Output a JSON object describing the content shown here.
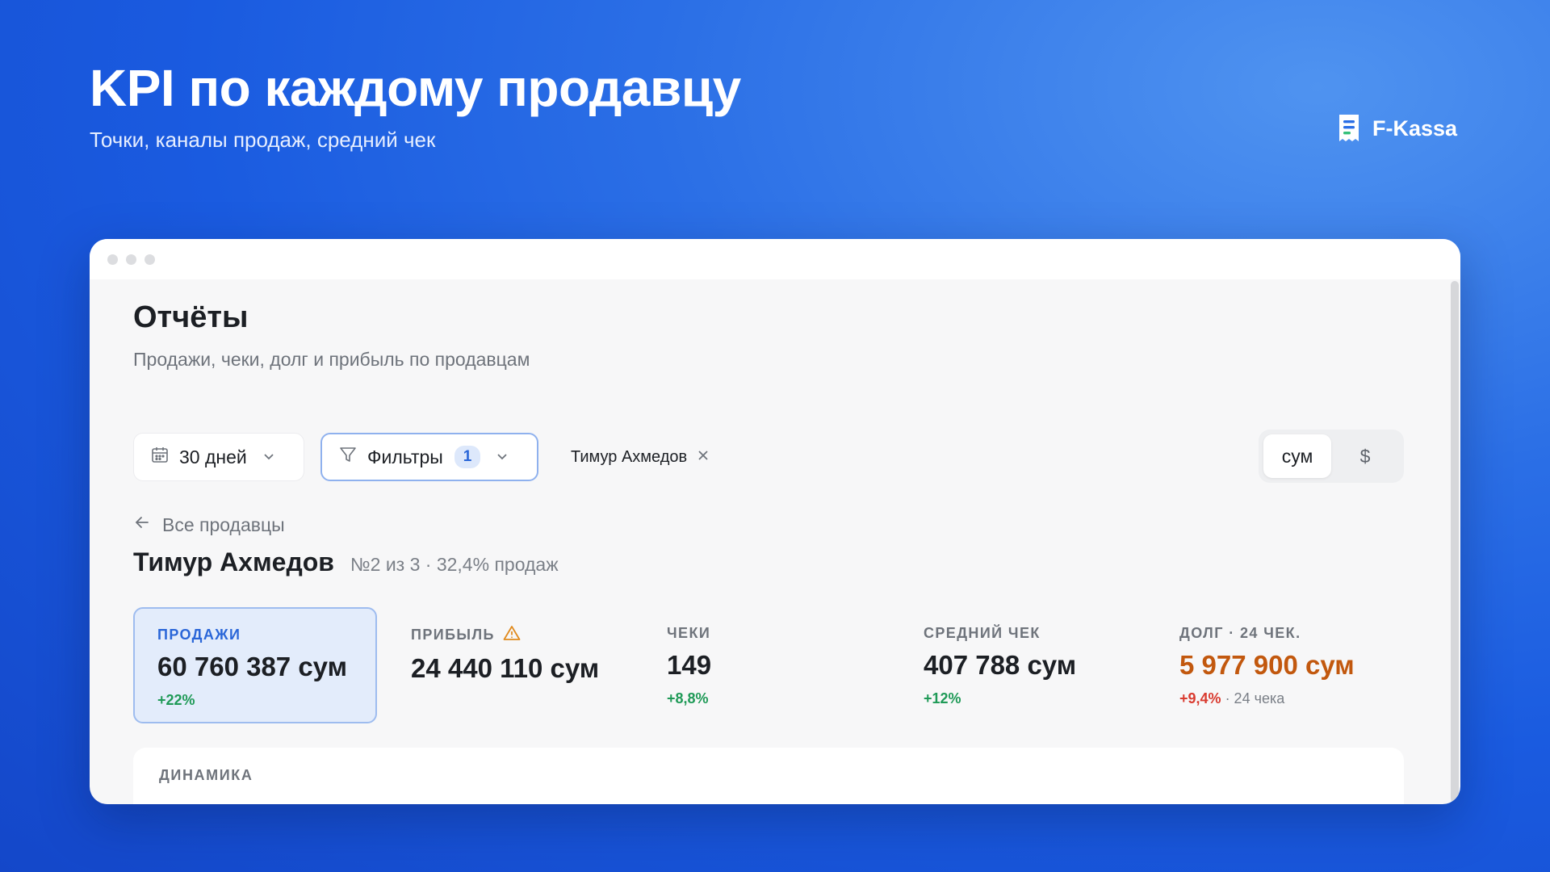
{
  "hero": {
    "title": "KPI по каждому продавцу",
    "subtitle": "Точки, каналы продаж, средний чек"
  },
  "brand": {
    "name": "F-Kassa",
    "icon": "receipt-logo-icon"
  },
  "page": {
    "title": "Отчёты",
    "subtitle": "Продажи, чеки, долг и прибыль по продавцам"
  },
  "toolbar": {
    "date_range": "30 дней",
    "filters_label": "Фильтры",
    "filters_count": "1",
    "active_chip": "Тимур Ахмедов",
    "currency_options": [
      "сум",
      "$"
    ],
    "currency_selected": "сум"
  },
  "seller": {
    "back_label": "Все продавцы",
    "name": "Тимур Ахмедов",
    "meta": "№2 из 3 · 32,4% продаж"
  },
  "kpis": [
    {
      "label": "ПРОДАЖИ",
      "value": "60 760 387 сум",
      "delta": "+22%",
      "active": true
    },
    {
      "label": "ПРИБЫЛЬ",
      "value": "24 440 110 сум",
      "delta": "",
      "warning": true
    },
    {
      "label": "ЧЕКИ",
      "value": "149",
      "delta": "+8,8%"
    },
    {
      "label": "СРЕДНИЙ ЧЕК",
      "value": "407 788 сум",
      "delta": "+12%"
    },
    {
      "label": "ДОЛГ · 24 ЧЕК.",
      "value": "5 977 900 сум",
      "delta": "+9,4%",
      "extra": "· 24 чека"
    }
  ],
  "dynamics": {
    "label": "ДИНАМИКА"
  },
  "colors": {
    "accent": "#2a66d8",
    "positive": "#1f9a57",
    "negative": "#d93b30",
    "debt": "#c2580e",
    "warning": "#e08a1e"
  }
}
